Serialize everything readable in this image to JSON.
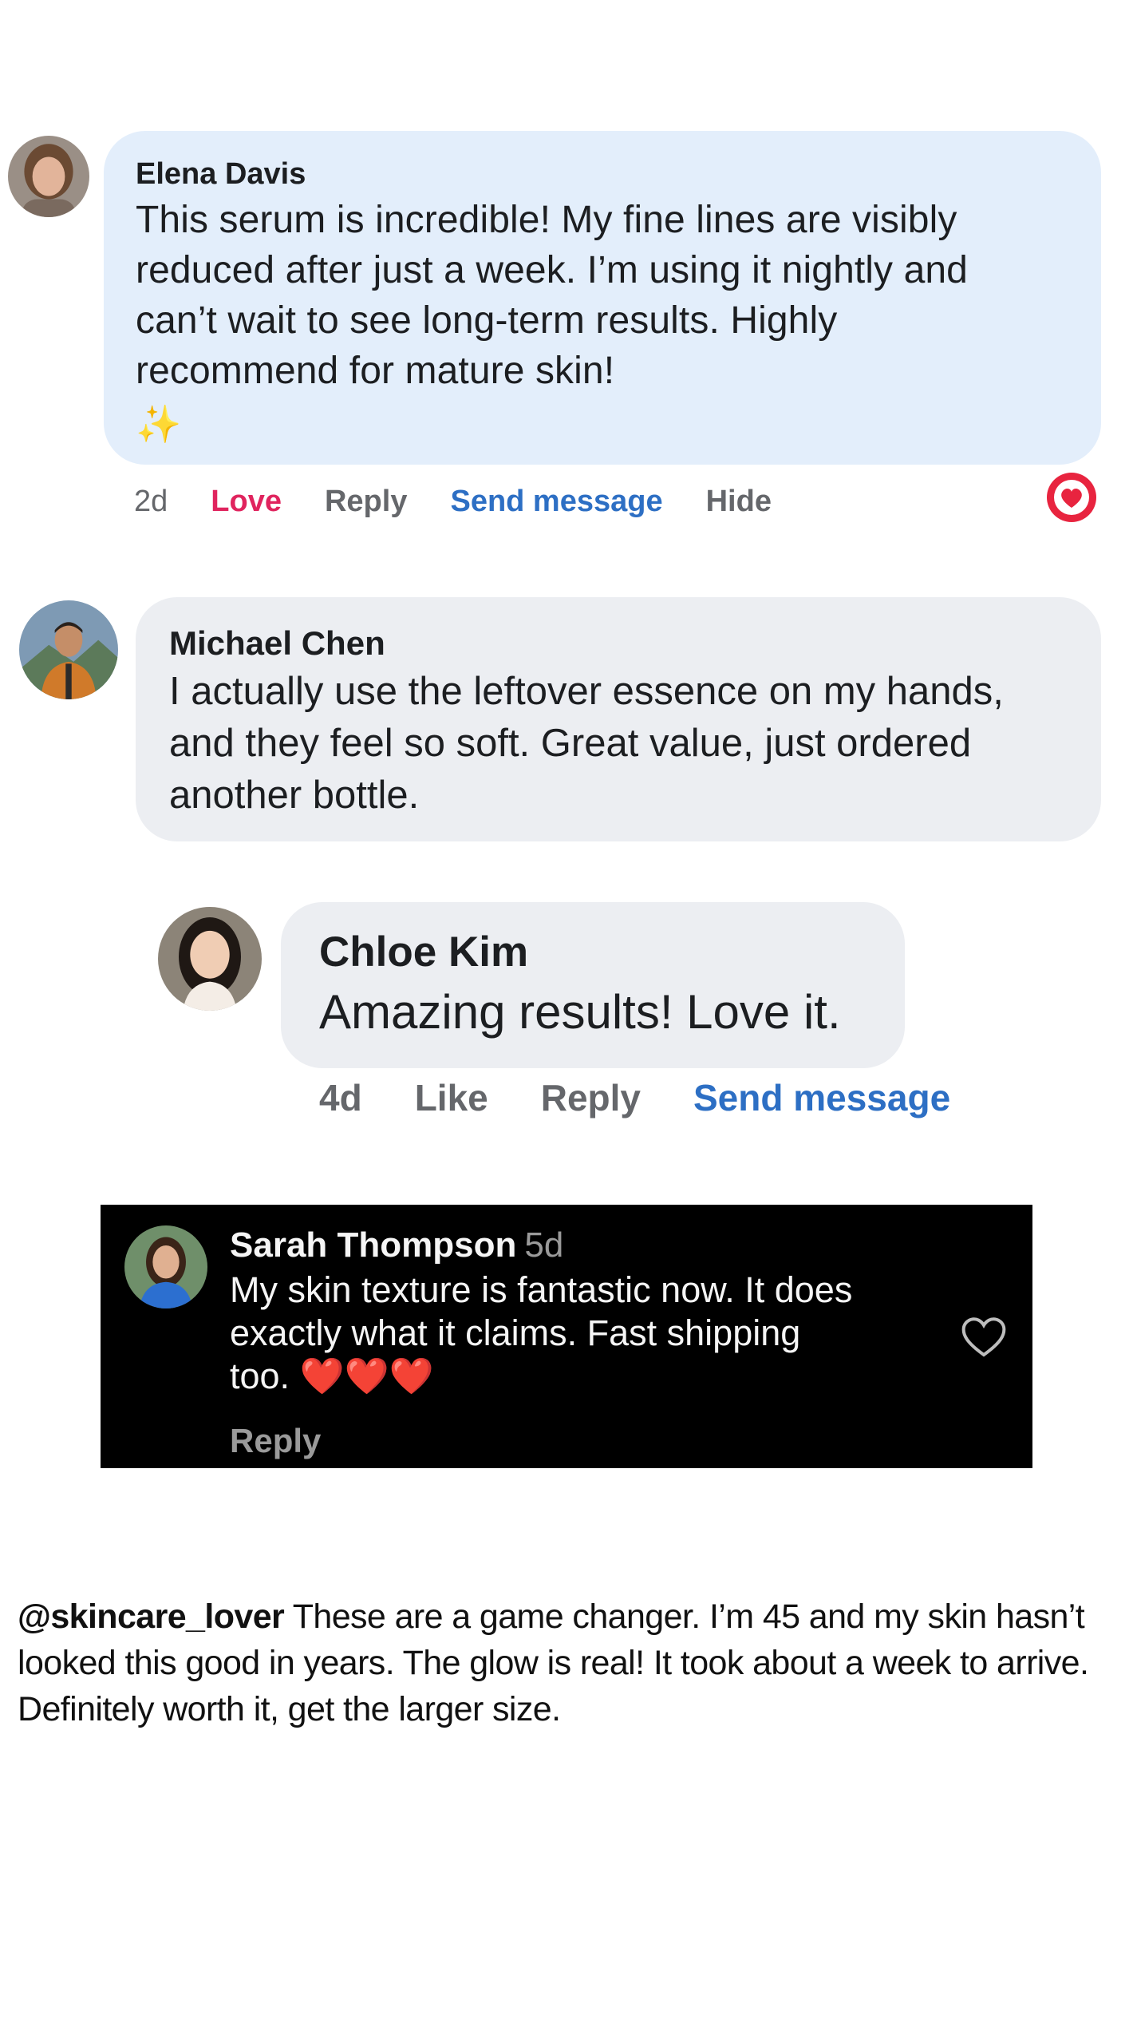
{
  "comments": {
    "c1": {
      "author": "Elena Davis",
      "text": "This serum is incredible! My fine lines are visibly reduced after just a week. I’m using it nightly and can’t wait to see long-term results. Highly recommend for mature skin!",
      "lines": [
        "This serum is incredible! My fine lines are visibly",
        "reduced after just a week. I’m using it nightly and",
        "can’t wait to see long-term results. Highly",
        "recommend for mature skin!"
      ],
      "emoji": "✨",
      "time": "2d",
      "actions": {
        "love": "Love",
        "reply": "Reply",
        "send": "Send message",
        "hide": "Hide"
      },
      "reaction_icon": "heart-reaction-icon"
    },
    "c2": {
      "author": "Michael Chen",
      "lines": [
        "I actually use the leftover essence on my hands,",
        "and they feel so soft. Great value, just ordered",
        "another bottle."
      ]
    },
    "c3": {
      "author": "Chloe Kim",
      "text": "Amazing results! Love it.",
      "time": "4d",
      "actions": {
        "like": "Like",
        "reply": "Reply",
        "send": "Send message"
      }
    },
    "c4": {
      "author": "Sarah Thompson",
      "time": "5d",
      "lines": [
        "My skin texture is fantastic now. It does",
        "exactly what it claims. Fast shipping",
        "too. ❤️❤️❤️"
      ],
      "reply": "Reply",
      "like_icon": "heart-outline-icon"
    },
    "c5": {
      "handle": "@skincare_lover",
      "line1_rest": " These are a game changer. I’m 45 and my skin hasn’t",
      "line2": "looked this good in years. The glow is real! It took about a week to arrive.",
      "line3": "Definitely worth it, get the larger size."
    }
  },
  "colors": {
    "bubble_blue": "#e3eefb",
    "bubble_gray": "#eceef2",
    "love_red": "#e0245e",
    "link_blue": "#2d6fc4",
    "muted_gray": "#65676b"
  }
}
